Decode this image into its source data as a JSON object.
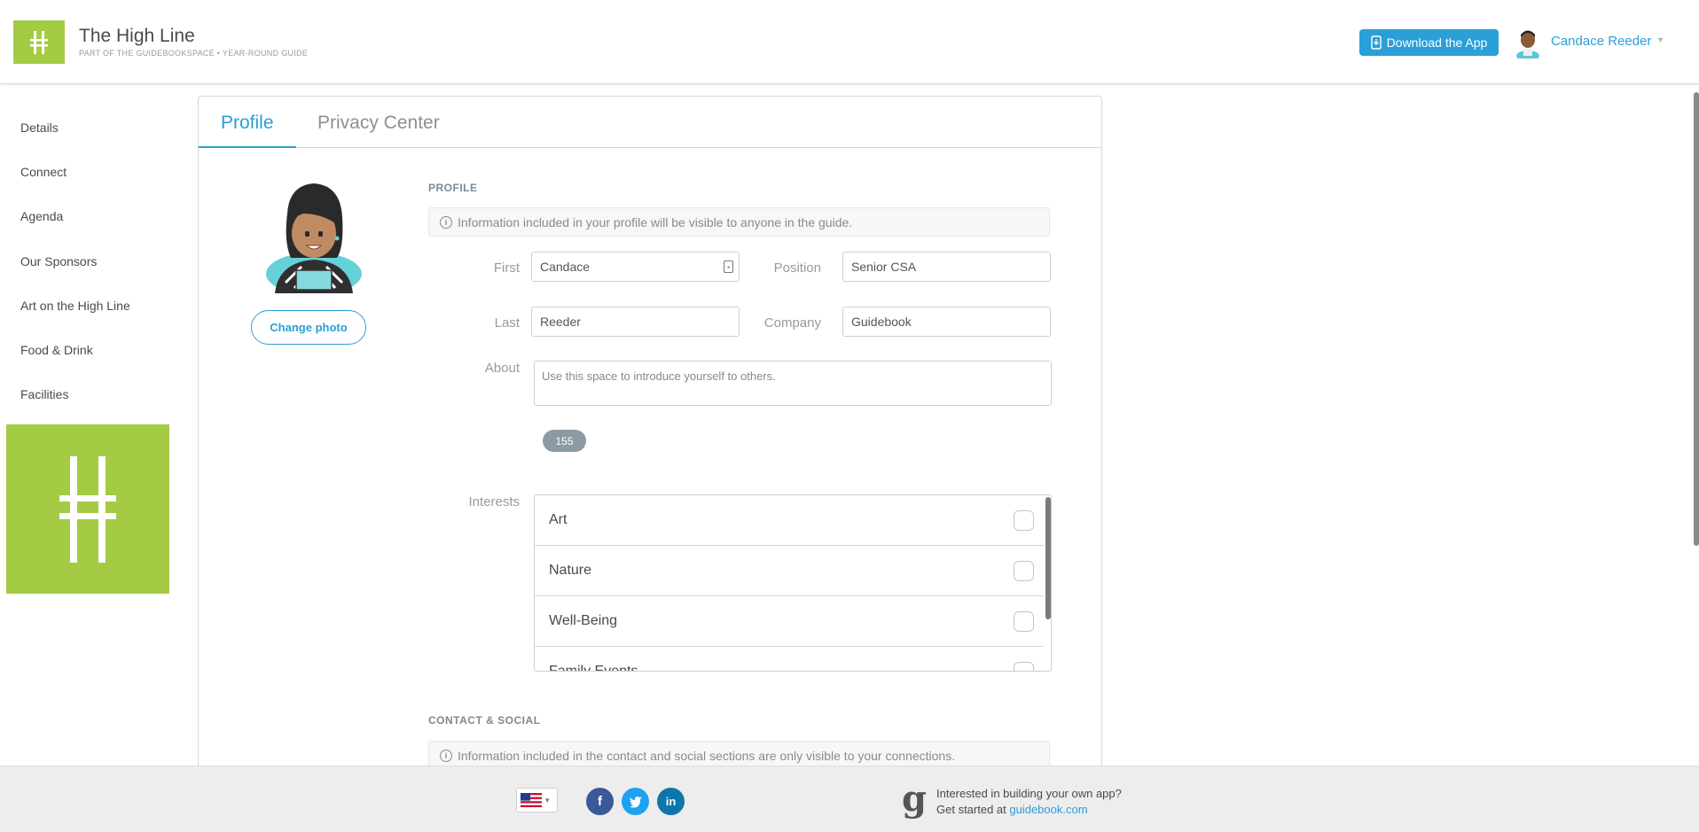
{
  "header": {
    "app_title": "The High Line",
    "app_subtitle": "PART OF THE GUIDEBOOKSPACE • YEAR-ROUND GUIDE",
    "download_label": "Download the App",
    "user_name": "Candace Reeder",
    "brand_color": "#a3cc44",
    "accent_color": "#2a9fd8"
  },
  "sidebar": {
    "items": [
      {
        "label": "Details"
      },
      {
        "label": "Connect"
      },
      {
        "label": "Agenda"
      },
      {
        "label": "Our Sponsors"
      },
      {
        "label": "Art on the High Line"
      },
      {
        "label": "Food & Drink"
      },
      {
        "label": "Facilities"
      }
    ]
  },
  "tabs": [
    {
      "label": "Profile",
      "active": true
    },
    {
      "label": "Privacy Center",
      "active": false
    }
  ],
  "profile": {
    "change_photo_label": "Change photo",
    "section_title": "PROFILE",
    "info_text": "Information included in your profile will be visible to anyone in the guide.",
    "fields": {
      "first_label": "First",
      "first_value": "Candace",
      "last_label": "Last",
      "last_value": "Reeder",
      "position_label": "Position",
      "position_value": "Senior CSA",
      "company_label": "Company",
      "company_value": "Guidebook",
      "about_label": "About",
      "about_placeholder": "Use this space to introduce yourself to others."
    },
    "char_count": "155",
    "interests_label": "Interests",
    "interests": [
      {
        "label": "Art",
        "checked": false
      },
      {
        "label": "Nature",
        "checked": false
      },
      {
        "label": "Well-Being",
        "checked": false
      },
      {
        "label": "Family Events",
        "checked": false
      }
    ]
  },
  "contact": {
    "section_title": "CONTACT & SOCIAL",
    "info_text": "Information included in the contact and social sections are only visible to your connections."
  },
  "footer": {
    "line1": "Interested in building your own app?",
    "line2_prefix": "Get started at ",
    "link": "guidebook.com",
    "social": [
      "facebook-icon",
      "twitter-icon",
      "linkedin-icon"
    ]
  }
}
